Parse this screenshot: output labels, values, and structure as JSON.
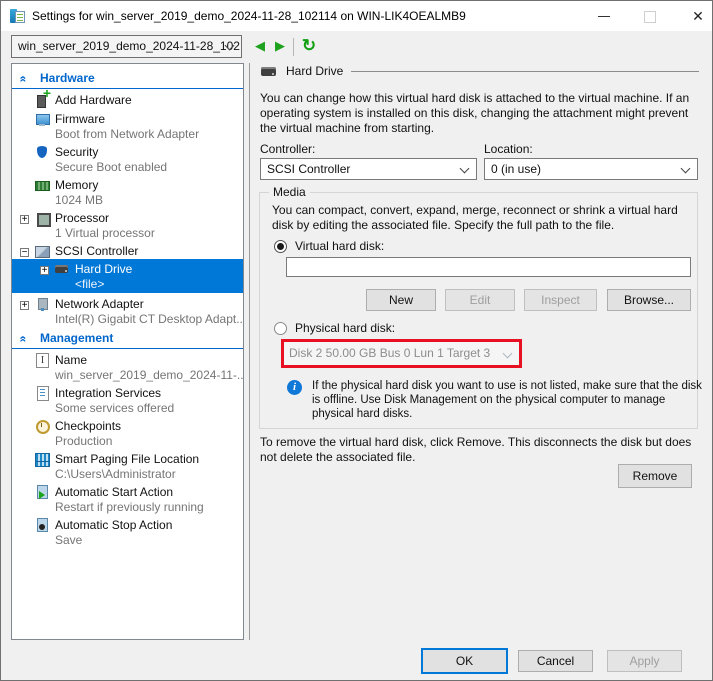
{
  "window": {
    "title": "Settings for win_server_2019_demo_2024-11-28_102114 on WIN-LIK4OEALMB9"
  },
  "toolbar": {
    "vm_selector_value": "win_server_2019_demo_2024-11-28_102"
  },
  "icons": {
    "back": "◀",
    "forward": "▶",
    "refresh": "↻",
    "close": "✕",
    "info": "i",
    "section_chevron": "«"
  },
  "sidebar": {
    "hardware": {
      "label": "Hardware",
      "items": [
        {
          "label": "Add Hardware",
          "sub": ""
        },
        {
          "label": "Firmware",
          "sub": "Boot from Network Adapter"
        },
        {
          "label": "Security",
          "sub": "Secure Boot enabled"
        },
        {
          "label": "Memory",
          "sub": "1024 MB"
        },
        {
          "label": "Processor",
          "sub": "1 Virtual processor",
          "expander": "+"
        },
        {
          "label": "SCSI Controller",
          "sub": "",
          "expander": "−"
        },
        {
          "label": "Hard Drive",
          "sub": "<file>",
          "expander": "+"
        },
        {
          "label": "Network Adapter",
          "sub": "Intel(R) Gigabit CT Desktop Adapt...",
          "expander": "+"
        }
      ]
    },
    "management": {
      "label": "Management",
      "items": [
        {
          "label": "Name",
          "sub": "win_server_2019_demo_2024-11-..."
        },
        {
          "label": "Integration Services",
          "sub": "Some services offered"
        },
        {
          "label": "Checkpoints",
          "sub": "Production"
        },
        {
          "label": "Smart Paging File Location",
          "sub": "C:\\Users\\Administrator"
        },
        {
          "label": "Automatic Start Action",
          "sub": "Restart if previously running"
        },
        {
          "label": "Automatic Stop Action",
          "sub": "Save"
        }
      ]
    }
  },
  "main": {
    "header": "Hard Drive",
    "intro": "You can change how this virtual hard disk is attached to the virtual machine. If an operating system is installed on this disk, changing the attachment might prevent the virtual machine from starting.",
    "controller_label": "Controller:",
    "controller_value": "SCSI Controller",
    "location_label": "Location:",
    "location_value": "0 (in use)",
    "media": {
      "legend": "Media",
      "description": "You can compact, convert, expand, merge, reconnect or shrink a virtual hard disk by editing the associated file. Specify the full path to the file.",
      "virtual_radio_label": "Virtual hard disk:",
      "virtual_path_value": "",
      "new_button": "New",
      "edit_button": "Edit",
      "inspect_button": "Inspect",
      "browse_button": "Browse...",
      "physical_radio_label": "Physical hard disk:",
      "physical_disk_value": "Disk 2 50.00 GB Bus 0 Lun 1 Target 3",
      "info_text": "If the physical hard disk you want to use is not listed, make sure that the disk is offline. Use Disk Management on the physical computer to manage physical hard disks."
    },
    "remove_text": "To remove the virtual hard disk, click Remove. This disconnects the disk but does not delete the associated file.",
    "remove_button": "Remove"
  },
  "footer": {
    "ok": "OK",
    "cancel": "Cancel",
    "apply": "Apply"
  },
  "colors": {
    "selection_blue": "#0078d7",
    "section_header_blue": "#0066cc",
    "highlight_red": "#e81123",
    "nav_green": "#1ea21e"
  }
}
